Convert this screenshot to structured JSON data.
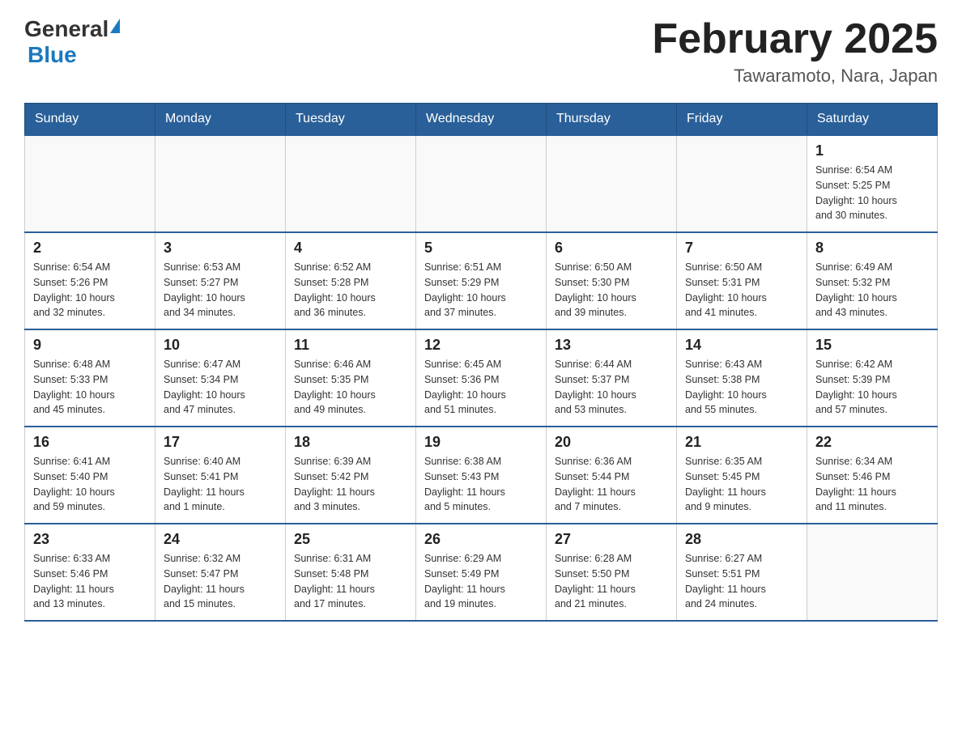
{
  "header": {
    "logo_general": "General",
    "logo_blue": "Blue",
    "month_title": "February 2025",
    "location": "Tawaramoto, Nara, Japan"
  },
  "weekdays": [
    "Sunday",
    "Monday",
    "Tuesday",
    "Wednesday",
    "Thursday",
    "Friday",
    "Saturday"
  ],
  "weeks": [
    [
      {
        "day": "",
        "info": ""
      },
      {
        "day": "",
        "info": ""
      },
      {
        "day": "",
        "info": ""
      },
      {
        "day": "",
        "info": ""
      },
      {
        "day": "",
        "info": ""
      },
      {
        "day": "",
        "info": ""
      },
      {
        "day": "1",
        "info": "Sunrise: 6:54 AM\nSunset: 5:25 PM\nDaylight: 10 hours\nand 30 minutes."
      }
    ],
    [
      {
        "day": "2",
        "info": "Sunrise: 6:54 AM\nSunset: 5:26 PM\nDaylight: 10 hours\nand 32 minutes."
      },
      {
        "day": "3",
        "info": "Sunrise: 6:53 AM\nSunset: 5:27 PM\nDaylight: 10 hours\nand 34 minutes."
      },
      {
        "day": "4",
        "info": "Sunrise: 6:52 AM\nSunset: 5:28 PM\nDaylight: 10 hours\nand 36 minutes."
      },
      {
        "day": "5",
        "info": "Sunrise: 6:51 AM\nSunset: 5:29 PM\nDaylight: 10 hours\nand 37 minutes."
      },
      {
        "day": "6",
        "info": "Sunrise: 6:50 AM\nSunset: 5:30 PM\nDaylight: 10 hours\nand 39 minutes."
      },
      {
        "day": "7",
        "info": "Sunrise: 6:50 AM\nSunset: 5:31 PM\nDaylight: 10 hours\nand 41 minutes."
      },
      {
        "day": "8",
        "info": "Sunrise: 6:49 AM\nSunset: 5:32 PM\nDaylight: 10 hours\nand 43 minutes."
      }
    ],
    [
      {
        "day": "9",
        "info": "Sunrise: 6:48 AM\nSunset: 5:33 PM\nDaylight: 10 hours\nand 45 minutes."
      },
      {
        "day": "10",
        "info": "Sunrise: 6:47 AM\nSunset: 5:34 PM\nDaylight: 10 hours\nand 47 minutes."
      },
      {
        "day": "11",
        "info": "Sunrise: 6:46 AM\nSunset: 5:35 PM\nDaylight: 10 hours\nand 49 minutes."
      },
      {
        "day": "12",
        "info": "Sunrise: 6:45 AM\nSunset: 5:36 PM\nDaylight: 10 hours\nand 51 minutes."
      },
      {
        "day": "13",
        "info": "Sunrise: 6:44 AM\nSunset: 5:37 PM\nDaylight: 10 hours\nand 53 minutes."
      },
      {
        "day": "14",
        "info": "Sunrise: 6:43 AM\nSunset: 5:38 PM\nDaylight: 10 hours\nand 55 minutes."
      },
      {
        "day": "15",
        "info": "Sunrise: 6:42 AM\nSunset: 5:39 PM\nDaylight: 10 hours\nand 57 minutes."
      }
    ],
    [
      {
        "day": "16",
        "info": "Sunrise: 6:41 AM\nSunset: 5:40 PM\nDaylight: 10 hours\nand 59 minutes."
      },
      {
        "day": "17",
        "info": "Sunrise: 6:40 AM\nSunset: 5:41 PM\nDaylight: 11 hours\nand 1 minute."
      },
      {
        "day": "18",
        "info": "Sunrise: 6:39 AM\nSunset: 5:42 PM\nDaylight: 11 hours\nand 3 minutes."
      },
      {
        "day": "19",
        "info": "Sunrise: 6:38 AM\nSunset: 5:43 PM\nDaylight: 11 hours\nand 5 minutes."
      },
      {
        "day": "20",
        "info": "Sunrise: 6:36 AM\nSunset: 5:44 PM\nDaylight: 11 hours\nand 7 minutes."
      },
      {
        "day": "21",
        "info": "Sunrise: 6:35 AM\nSunset: 5:45 PM\nDaylight: 11 hours\nand 9 minutes."
      },
      {
        "day": "22",
        "info": "Sunrise: 6:34 AM\nSunset: 5:46 PM\nDaylight: 11 hours\nand 11 minutes."
      }
    ],
    [
      {
        "day": "23",
        "info": "Sunrise: 6:33 AM\nSunset: 5:46 PM\nDaylight: 11 hours\nand 13 minutes."
      },
      {
        "day": "24",
        "info": "Sunrise: 6:32 AM\nSunset: 5:47 PM\nDaylight: 11 hours\nand 15 minutes."
      },
      {
        "day": "25",
        "info": "Sunrise: 6:31 AM\nSunset: 5:48 PM\nDaylight: 11 hours\nand 17 minutes."
      },
      {
        "day": "26",
        "info": "Sunrise: 6:29 AM\nSunset: 5:49 PM\nDaylight: 11 hours\nand 19 minutes."
      },
      {
        "day": "27",
        "info": "Sunrise: 6:28 AM\nSunset: 5:50 PM\nDaylight: 11 hours\nand 21 minutes."
      },
      {
        "day": "28",
        "info": "Sunrise: 6:27 AM\nSunset: 5:51 PM\nDaylight: 11 hours\nand 24 minutes."
      },
      {
        "day": "",
        "info": ""
      }
    ]
  ]
}
